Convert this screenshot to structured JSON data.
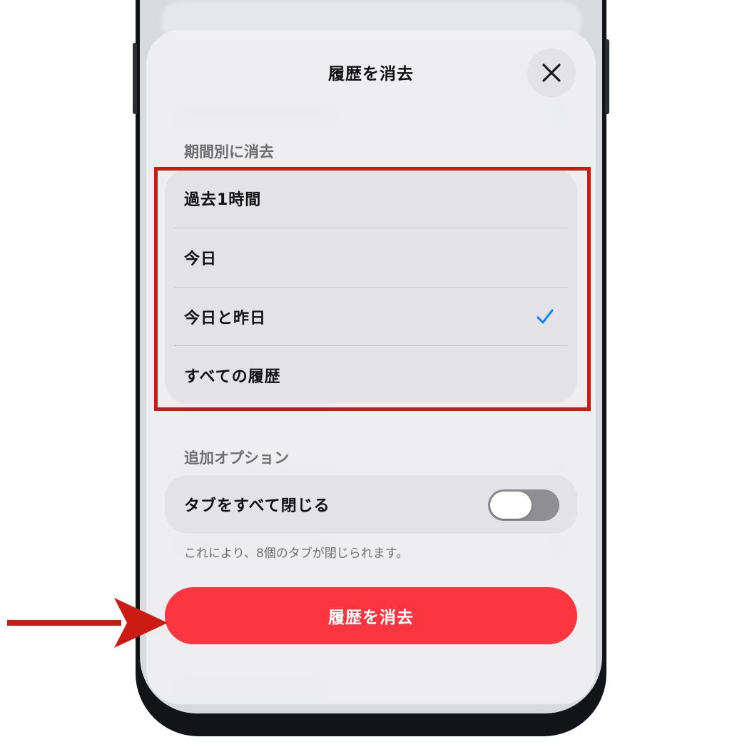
{
  "sheet": {
    "title": "履歴を消去",
    "close_icon": "close-icon"
  },
  "period_section": {
    "label": "期間別に消去",
    "options": [
      {
        "label": "過去1時間",
        "selected": false
      },
      {
        "label": "今日",
        "selected": false
      },
      {
        "label": "今日と昨日",
        "selected": true
      },
      {
        "label": "すべての履歴",
        "selected": false
      }
    ]
  },
  "additional_section": {
    "label": "追加オプション",
    "close_tabs_label": "タブをすべて閉じる",
    "close_tabs_enabled": false,
    "footnote": "これにより、8個のタブが閉じられます。"
  },
  "primary_button": {
    "label": "履歴を消去",
    "color": "#fb3640"
  },
  "colors": {
    "accent": "#0a84ff",
    "annotation": "#cc1a14"
  }
}
